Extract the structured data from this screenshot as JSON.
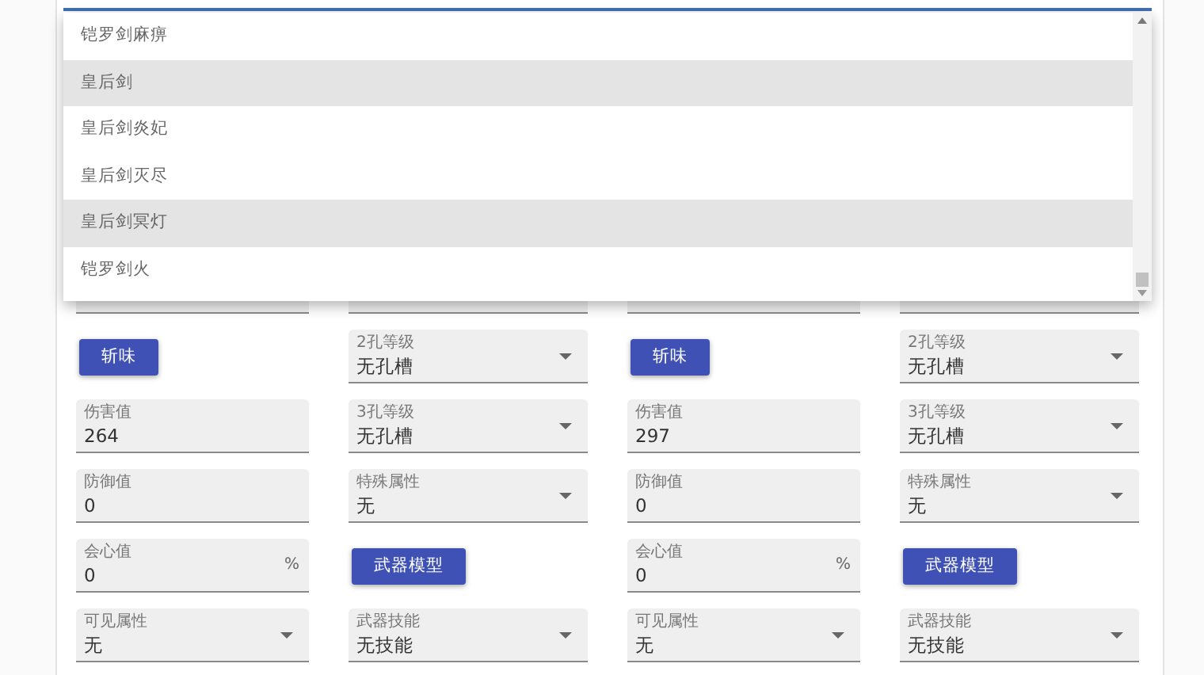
{
  "dropdown": {
    "options": [
      {
        "label": "铠罗剑麻痹",
        "highlighted": false
      },
      {
        "label": "皇后剑",
        "highlighted": true
      },
      {
        "label": "皇后剑炎妃",
        "highlighted": false
      },
      {
        "label": "皇后剑灭尽",
        "highlighted": false
      },
      {
        "label": "皇后剑冥灯",
        "highlighted": true
      },
      {
        "label": "铠罗剑火",
        "highlighted": false
      }
    ]
  },
  "panels": [
    {
      "left_column": [
        {
          "kind": "button",
          "label": "斩味"
        },
        {
          "kind": "text",
          "label": "伤害值",
          "value": "264"
        },
        {
          "kind": "text",
          "label": "防御值",
          "value": "0"
        },
        {
          "kind": "text",
          "label": "会心值",
          "value": "0",
          "suffix": "%"
        },
        {
          "kind": "select",
          "label": "可见属性",
          "value": "无"
        }
      ],
      "right_column": [
        {
          "kind": "select",
          "label": "2孔等级",
          "value": "无孔槽"
        },
        {
          "kind": "select",
          "label": "3孔等级",
          "value": "无孔槽"
        },
        {
          "kind": "select",
          "label": "特殊属性",
          "value": "无"
        },
        {
          "kind": "button",
          "label": "武器模型"
        },
        {
          "kind": "select",
          "label": "武器技能",
          "value": "无技能"
        }
      ]
    },
    {
      "left_column": [
        {
          "kind": "button",
          "label": "斩味"
        },
        {
          "kind": "text",
          "label": "伤害值",
          "value": "297"
        },
        {
          "kind": "text",
          "label": "防御值",
          "value": "0"
        },
        {
          "kind": "text",
          "label": "会心值",
          "value": "0",
          "suffix": "%"
        },
        {
          "kind": "select",
          "label": "可见属性",
          "value": "无"
        }
      ],
      "right_column": [
        {
          "kind": "select",
          "label": "2孔等级",
          "value": "无孔槽"
        },
        {
          "kind": "select",
          "label": "3孔等级",
          "value": "无孔槽"
        },
        {
          "kind": "select",
          "label": "特殊属性",
          "value": "无"
        },
        {
          "kind": "button",
          "label": "武器模型"
        },
        {
          "kind": "select",
          "label": "武器技能",
          "value": "无技能"
        }
      ]
    }
  ]
}
